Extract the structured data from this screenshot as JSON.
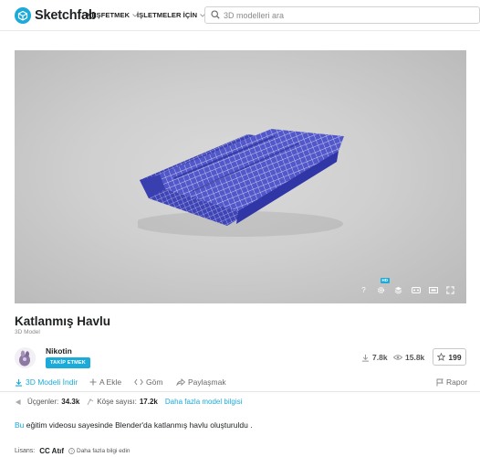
{
  "header": {
    "brand": "Sketchfab",
    "nav": [
      {
        "label": "KEŞFETMEK"
      },
      {
        "label": "İŞLETMELER İÇİN"
      }
    ],
    "search_placeholder": "3D modelleri ara"
  },
  "viewer": {
    "hd_badge": "HD",
    "controls": [
      "help-icon",
      "settings-icon",
      "layers-icon",
      "vr-icon",
      "cardboard-icon",
      "fullscreen-icon"
    ]
  },
  "model": {
    "title": "Katlanmış Havlu",
    "subtitle": "3D Model"
  },
  "author": {
    "name": "Nikotin",
    "follow_label": "TAKİP ETMEK"
  },
  "stats": {
    "downloads": "7.8k",
    "views": "15.8k",
    "likes": "199"
  },
  "actions": {
    "download": "3D Modeli İndir",
    "add": "A Ekle",
    "embed": "Göm",
    "share": "Paylaşmak",
    "report": "Rapor"
  },
  "info": {
    "triangles_label": "Üçgenler:",
    "triangles_value": "34.3k",
    "vertices_label": "Köşe sayısı:",
    "vertices_value": "17.2k",
    "more_info": "Daha fazla model bilgisi"
  },
  "description": {
    "link": "Bu",
    "text": " eğitim videosu sayesinde Blender'da katlanmış havlu oluşturuldu ."
  },
  "license": {
    "label": "Lisans:",
    "name": "CC Atıf",
    "more": "Daha fazla bilgi edin"
  },
  "colors": {
    "accent": "#1caad9",
    "towel": "#4a4fc4"
  }
}
